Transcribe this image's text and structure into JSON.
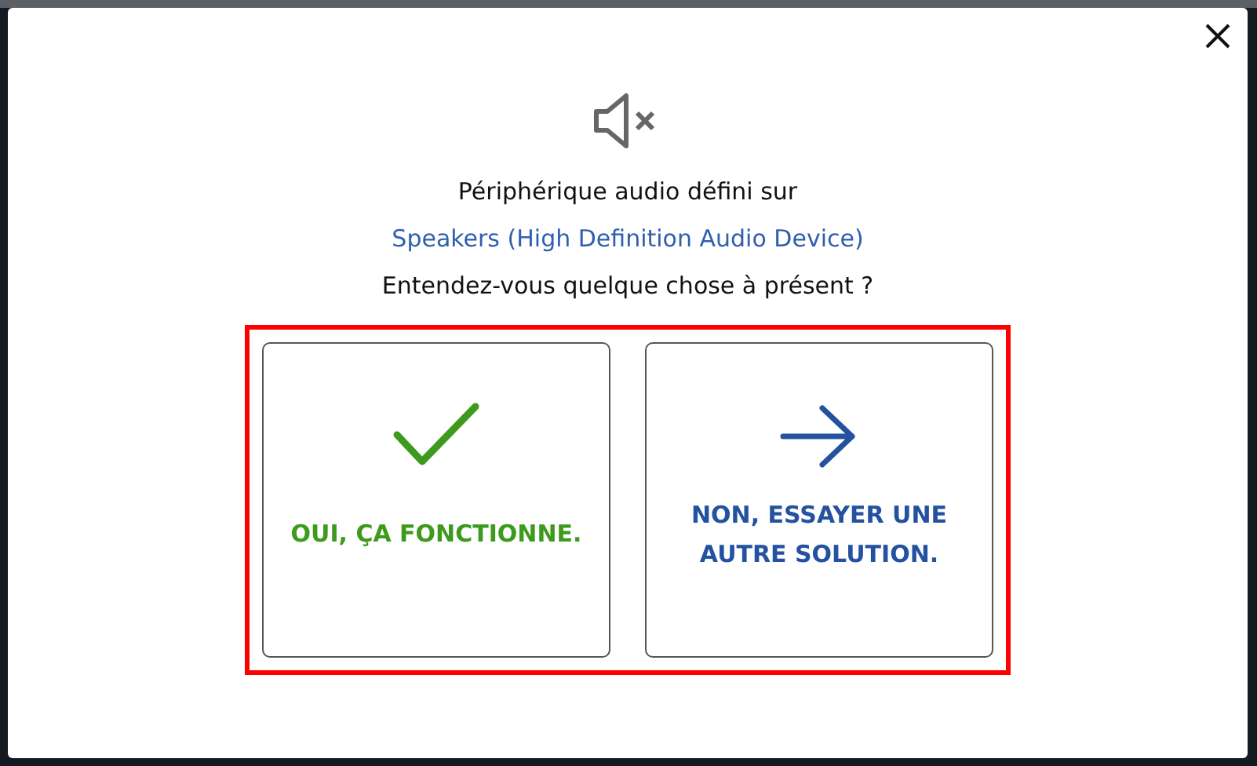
{
  "dialog": {
    "message": "Périphérique audio défini sur",
    "device": "Speakers (High Definition Audio Device)",
    "question": "Entendez-vous quelque chose à présent ?"
  },
  "options_highlighted": true,
  "options": [
    {
      "kind": "check",
      "label": "OUI, ÇA FONCTIONNE.",
      "color": "#3d9a1c"
    },
    {
      "kind": "arrow",
      "label": "NON, ESSAYER UNE AUTRE SOLUTION.",
      "color": "#2452a0"
    }
  ]
}
